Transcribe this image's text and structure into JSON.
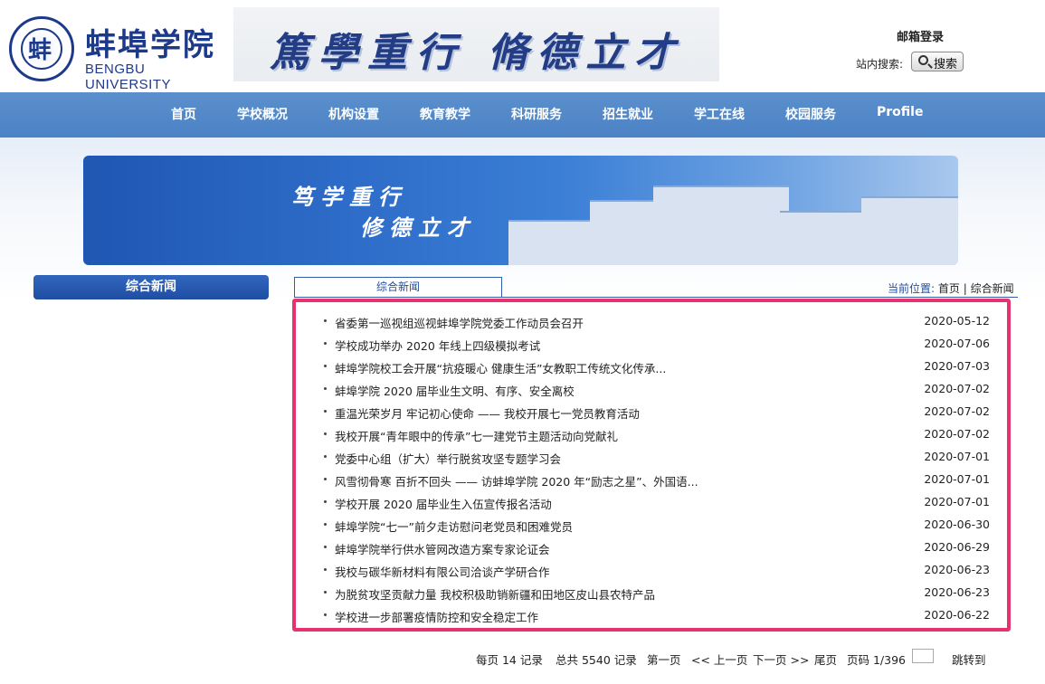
{
  "header": {
    "logo_cn": "蚌埠学院",
    "logo_en": "BENGBU UNIVERSITY",
    "logo_mark": "蚌",
    "slogan": "篤學重行 脩德立才",
    "mail_login": "邮箱登录",
    "site_search_label": "站内搜索:",
    "search_button": "搜索"
  },
  "nav": [
    "首页",
    "学校概况",
    "机构设置",
    "教育教学",
    "科研服务",
    "招生就业",
    "学工在线",
    "校园服务",
    "Profile"
  ],
  "hero": {
    "line1": "笃学重行",
    "line2": "修德立才"
  },
  "sidebar": {
    "title": "综合新闻"
  },
  "tab": {
    "label": "综合新闻"
  },
  "breadcrumb": {
    "label": "当前位置:",
    "home": "首页",
    "sep": "|",
    "current": "综合新闻"
  },
  "news": [
    {
      "title": "省委第一巡视组巡视蚌埠学院党委工作动员会召开",
      "date": "2020-05-12"
    },
    {
      "title": "学校成功举办 2020 年线上四级模拟考试",
      "date": "2020-07-06"
    },
    {
      "title": "蚌埠学院校工会开展“抗疫暖心 健康生活”女教职工传统文化传承...",
      "date": "2020-07-03"
    },
    {
      "title": "蚌埠学院 2020 届毕业生文明、有序、安全离校",
      "date": "2020-07-02"
    },
    {
      "title": "重温光荣岁月 牢记初心使命 —— 我校开展七一党员教育活动",
      "date": "2020-07-02"
    },
    {
      "title": "我校开展“青年眼中的传承”七一建党节主题活动向党献礼",
      "date": "2020-07-02"
    },
    {
      "title": "党委中心组（扩大）举行脱贫攻坚专题学习会",
      "date": "2020-07-01"
    },
    {
      "title": "风雪彻骨寒 百折不回头 —— 访蚌埠学院 2020 年“励志之星”、外国语...",
      "date": "2020-07-01"
    },
    {
      "title": "学校开展 2020 届毕业生入伍宣传报名活动",
      "date": "2020-07-01"
    },
    {
      "title": "蚌埠学院“七一”前夕走访慰问老党员和困难党员",
      "date": "2020-06-30"
    },
    {
      "title": "蚌埠学院举行供水管网改造方案专家论证会",
      "date": "2020-06-29"
    },
    {
      "title": "我校与碳华新材料有限公司洽谈产学研合作",
      "date": "2020-06-23"
    },
    {
      "title": "为脱贫攻坚贡献力量 我校积极助销新疆和田地区皮山县农特产品",
      "date": "2020-06-23"
    },
    {
      "title": "学校进一步部署疫情防控和安全稳定工作",
      "date": "2020-06-22"
    }
  ],
  "pager": {
    "per_page": "每页 14 记录",
    "total": "总共 5540 记录",
    "first": "第一页",
    "prev": "<< 上一页",
    "next": "下一页 >>",
    "last": "尾页",
    "page_info": "页码 1/396",
    "jump": "跳转到"
  },
  "colors": {
    "nav_bg": "#4c83c6",
    "brand_blue": "#1d3a8a",
    "highlight_border": "#e5336f"
  }
}
